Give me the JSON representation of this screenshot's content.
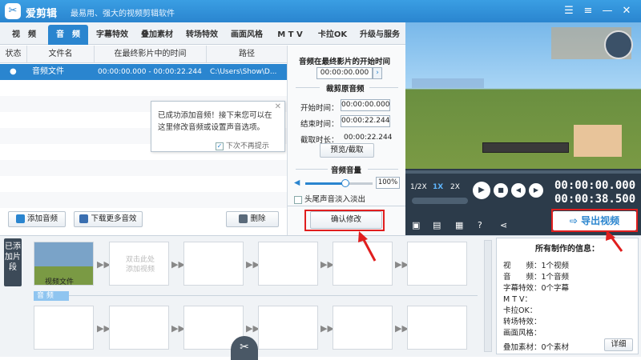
{
  "app": {
    "name": "爱剪辑",
    "slogan": "最易用、强大的视频剪辑软件"
  },
  "tabs": [
    "视　频",
    "音　频",
    "字幕特效",
    "叠加素材",
    "转场特效",
    "画面风格",
    "M T V",
    "卡拉OK",
    "升级与服务"
  ],
  "table": {
    "headers": [
      "状态",
      "文件名",
      "在最终影片中的时间",
      "路径"
    ],
    "rows": [
      {
        "status": "●",
        "name": "音频文件",
        "time": "00:00:00.000 - 00:00:22.244",
        "path": "C:\\Users\\Show\\D..."
      }
    ]
  },
  "tooltip": {
    "text": "已成功添加音频！接下来您可以在这里修改音频或设置声音选项。",
    "checkbox": "下次不再提示",
    "close": "✕"
  },
  "buttons": {
    "add_audio": "添加音频",
    "download_more": "下载更多音效",
    "delete": "删除"
  },
  "panel": {
    "start_title": "音频在最终影片的开始时间",
    "start_time": "00:00:00.000",
    "trim_title": "裁剪原音频",
    "start_label": "开始时间：",
    "start_value": "00:00:00.000",
    "end_label": "结束时间：",
    "end_value": "00:00:22.244",
    "duration_label": "截取时长：",
    "duration_value": "00:00:22.244",
    "preview_button": "预览/截取",
    "volume_title": "音频音量",
    "volume_value": "100%",
    "volume_level": 0.6,
    "fade_label": "头尾声音淡入淡出",
    "confirm_button": "确认修改"
  },
  "player": {
    "speed": [
      "1/2X",
      "1X",
      "2X"
    ],
    "active_speed": "1X",
    "timecode_current": "00:00:00.000",
    "timecode_total": "00:00:38.500",
    "export_button": "导出视频"
  },
  "lower": {
    "side_label": "已添加片段",
    "clip_label": "视频文件",
    "empty_slot": "双击此处\n添加视频",
    "audio_track": "音 频"
  },
  "info": {
    "title": "所有制作的信息：",
    "lines": [
      {
        "label": "视　　频：",
        "value": "1个视频"
      },
      {
        "label": "音　　频：",
        "value": "1个音频"
      },
      {
        "label": "字幕特效：",
        "value": "0个字幕"
      },
      {
        "label": "M T V：",
        "value": ""
      },
      {
        "label": "卡拉OK：",
        "value": ""
      },
      {
        "label": "转场特效：",
        "value": ""
      },
      {
        "label": "画面风格：",
        "value": ""
      },
      {
        "label": "叠加素材：",
        "value": "0个素材"
      }
    ],
    "detail_button": "详细"
  },
  "colors": {
    "accent": "#2a85cf",
    "highlight": "#e01e1e",
    "dark": "#2c3b4a"
  }
}
